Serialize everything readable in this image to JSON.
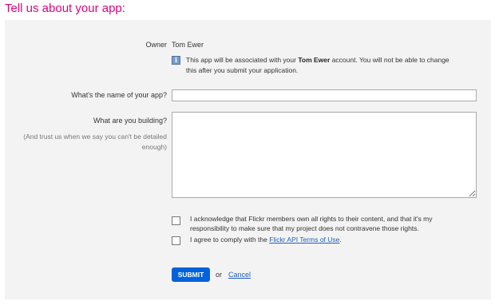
{
  "page": {
    "title": "Tell us about your app:"
  },
  "owner": {
    "label": "Owner",
    "name": "Tom Ewer",
    "info_icon": "info-icon",
    "info_before": "This app will be associated with your ",
    "info_bold": "Tom Ewer",
    "info_after": " account. You will not be able to change this after you submit your application."
  },
  "app_name": {
    "label": "What's the name of your app?",
    "value": ""
  },
  "building": {
    "label": "What are you building?",
    "hint": "(And trust us when we say you can't be detailed enough)",
    "value": ""
  },
  "agreements": {
    "rights_text": "I acknowledge that Flickr members own all rights to their content, and that it's my responsibility to make sure that my project does not contravene those rights.",
    "terms_before": "I agree to comply with the ",
    "terms_link": "Flickr API Terms of Use",
    "terms_after": "."
  },
  "actions": {
    "submit_label": "SUBMIT",
    "or_text": "or",
    "cancel_label": "Cancel"
  },
  "colors": {
    "title": "#e5007d",
    "button": "#0063dc",
    "link": "#1f5fc0",
    "panel": "#f3f3f3"
  }
}
